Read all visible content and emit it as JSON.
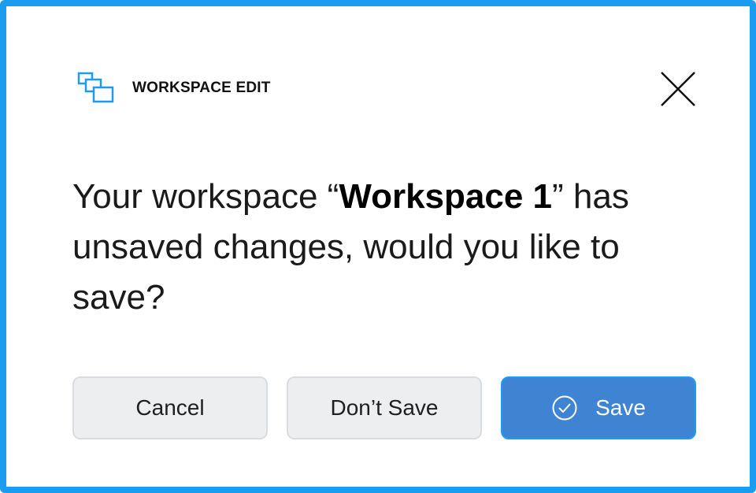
{
  "dialog": {
    "title": "WORKSPACE EDIT",
    "icon": "windows-icon",
    "close_icon": "close-icon",
    "message": {
      "prefix": "Your workspace “",
      "workspace_name": "Workspace 1",
      "suffix": "” has unsaved changes, would you like to save?"
    },
    "buttons": {
      "cancel_label": "Cancel",
      "dont_save_label": "Don’t Save",
      "save_label": "Save",
      "save_icon": "check-circle-icon"
    }
  },
  "colors": {
    "border": "#1a9cf0",
    "icon_accent": "#1a9cf0",
    "primary_button": "#3e84d2",
    "secondary_button": "#eceeef",
    "text": "#1a1a1a"
  }
}
